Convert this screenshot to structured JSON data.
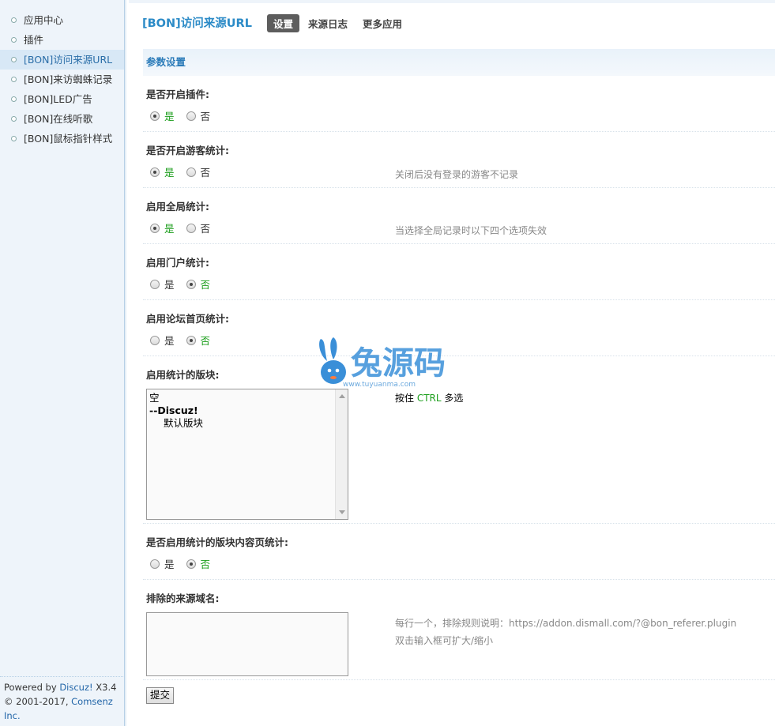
{
  "sidebar": {
    "items": [
      {
        "label": "应用中心"
      },
      {
        "label": "插件"
      },
      {
        "label": "[BON]访问来源URL"
      },
      {
        "label": "[BON]来访蜘蛛记录"
      },
      {
        "label": "[BON]LED广告"
      },
      {
        "label": "[BON]在线听歌"
      },
      {
        "label": "[BON]鼠标指针样式"
      }
    ],
    "active_index": 2,
    "powered_prefix": "Powered by ",
    "powered_link": "Discuz!",
    "powered_version": " X3.4",
    "copyright_prefix": "© 2001-2017, ",
    "copyright_link": "Comsenz Inc."
  },
  "header": {
    "title": "[BON]访问来源URL",
    "tabs": [
      {
        "label": "设置",
        "active": true
      },
      {
        "label": "来源日志",
        "active": false
      },
      {
        "label": "更多应用",
        "active": false
      }
    ]
  },
  "section_title": "参数设置",
  "settings": {
    "enable_plugin": {
      "label": "是否开启插件:",
      "yes": "是",
      "no": "否",
      "value": "yes"
    },
    "guest_stats": {
      "label": "是否开启游客统计:",
      "yes": "是",
      "no": "否",
      "value": "yes",
      "tip": "关闭后没有登录的游客不记录"
    },
    "global_stats": {
      "label": "启用全局统计:",
      "yes": "是",
      "no": "否",
      "value": "yes",
      "tip": "当选择全局记录时以下四个选项失效"
    },
    "portal_stats": {
      "label": "启用门户统计:",
      "yes": "是",
      "no": "否",
      "value": "no"
    },
    "forum_index_stats": {
      "label": "启用论坛首页统计:",
      "yes": "是",
      "no": "否",
      "value": "no"
    },
    "forums": {
      "label": "启用统计的版块:",
      "options": [
        "空",
        "--Discuz!",
        "默认版块"
      ],
      "tip_prefix": "按住 ",
      "tip_key": "CTRL",
      "tip_suffix": " 多选"
    },
    "forum_content_stats": {
      "label": "是否启用统计的版块内容页统计:",
      "yes": "是",
      "no": "否",
      "value": "no"
    },
    "exclude_domains": {
      "label": "排除的来源域名:",
      "value": "",
      "tip_line1": "每行一个，排除规则说明：https://addon.dismall.com/?@bon_referer.plugin",
      "tip_line2": "双击输入框可扩大/缩小"
    }
  },
  "submit_label": "提交",
  "watermark": {
    "text": "兔源码",
    "url": "www.tuyuanma.com"
  },
  "colors": {
    "accent": "#2c8bc7",
    "selected": "#1c9e1c",
    "sidebar_bg": "#eef4fa"
  }
}
